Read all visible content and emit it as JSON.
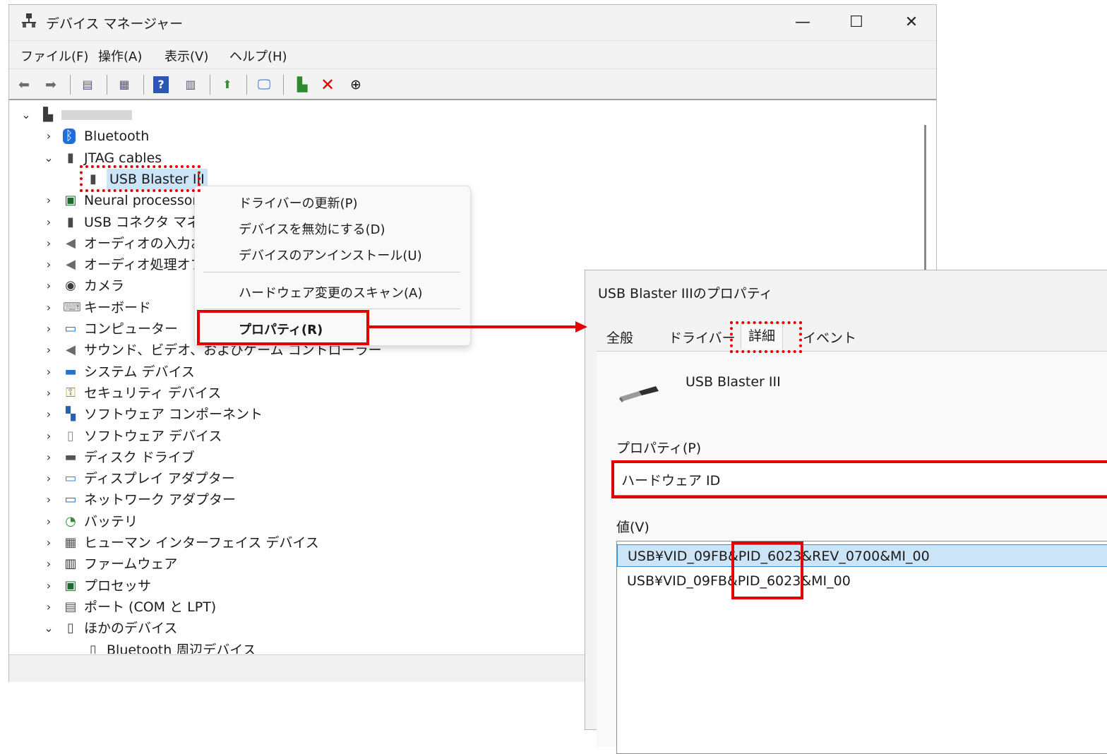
{
  "device_manager": {
    "title": "デバイス マネージャー",
    "menu": [
      "ファイル(F)",
      "操作(A)",
      "表示(V)",
      "ヘルプ(H)"
    ],
    "tree": [
      {
        "label": "",
        "chev": "⌄",
        "level": 0,
        "icon": "computer-icon"
      },
      {
        "label": "Bluetooth",
        "chev": "›",
        "level": 1,
        "icon": "bluetooth-icon"
      },
      {
        "label": "JTAG cables",
        "chev": "⌄",
        "level": 1,
        "icon": "plug-icon"
      },
      {
        "label": "USB Blaster III",
        "chev": "",
        "level": 2,
        "icon": "plug-icon",
        "selected": true
      },
      {
        "label": "Neural processor",
        "chev": "›",
        "level": 1,
        "icon": "chip-icon"
      },
      {
        "label": "USB コネクタ マネー",
        "chev": "›",
        "level": 1,
        "icon": "plug-icon"
      },
      {
        "label": "オーディオの入力お",
        "chev": "›",
        "level": 1,
        "icon": "speaker-icon"
      },
      {
        "label": "オーディオ処理オブジ",
        "chev": "›",
        "level": 1,
        "icon": "speaker-icon"
      },
      {
        "label": "カメラ",
        "chev": "›",
        "level": 1,
        "icon": "camera-icon"
      },
      {
        "label": "キーボード",
        "chev": "›",
        "level": 1,
        "icon": "keyboard-icon"
      },
      {
        "label": "コンピューター",
        "chev": "›",
        "level": 1,
        "icon": "monitor-icon"
      },
      {
        "label": "サウンド、ビデオ、およびゲーム コントローラー",
        "chev": "›",
        "level": 1,
        "icon": "speaker-icon"
      },
      {
        "label": "システム デバイス",
        "chev": "›",
        "level": 1,
        "icon": "folder-icon"
      },
      {
        "label": "セキュリティ デバイス",
        "chev": "›",
        "level": 1,
        "icon": "key-icon"
      },
      {
        "label": "ソフトウェア コンポーネント",
        "chev": "›",
        "level": 1,
        "icon": "component-icon"
      },
      {
        "label": "ソフトウェア デバイス",
        "chev": "›",
        "level": 1,
        "icon": "device-icon"
      },
      {
        "label": "ディスク ドライブ",
        "chev": "›",
        "level": 1,
        "icon": "disk-icon"
      },
      {
        "label": "ディスプレイ アダプター",
        "chev": "›",
        "level": 1,
        "icon": "display-icon"
      },
      {
        "label": "ネットワーク アダプター",
        "chev": "›",
        "level": 1,
        "icon": "network-icon"
      },
      {
        "label": "バッテリ",
        "chev": "›",
        "level": 1,
        "icon": "battery-icon"
      },
      {
        "label": "ヒューマン インターフェイス デバイス",
        "chev": "›",
        "level": 1,
        "icon": "hid-icon"
      },
      {
        "label": "ファームウェア",
        "chev": "›",
        "level": 1,
        "icon": "firmware-icon"
      },
      {
        "label": "プロセッサ",
        "chev": "›",
        "level": 1,
        "icon": "chip-icon"
      },
      {
        "label": "ポート (COM と LPT)",
        "chev": "›",
        "level": 1,
        "icon": "port-icon"
      },
      {
        "label": "ほかのデバイス",
        "chev": "⌄",
        "level": 1,
        "icon": "unknown-device-icon"
      },
      {
        "label": "Bluetooth 周辺デバイス",
        "chev": "",
        "level": 2,
        "icon": "unknown-device-icon"
      }
    ]
  },
  "context_menu": {
    "items": [
      "ドライバーの更新(P)",
      "デバイスを無効にする(D)",
      "デバイスのアンインストール(U)",
      "ハードウェア変更のスキャン(A)",
      "プロパティ(R)"
    ]
  },
  "properties_dialog": {
    "title": "USB Blaster IIIのプロパティ",
    "tabs": [
      "全般",
      "ドライバー",
      "詳細",
      "イベント"
    ],
    "device_name": "USB Blaster III",
    "property_label": "プロパティ(P)",
    "property_value": "ハードウェア ID",
    "value_label": "値(V)",
    "values": [
      "USB¥VID_09FB&PID_6023&REV_0700&MI_00",
      "USB¥VID_09FB&PID_6023&MI_00"
    ]
  },
  "colors": {
    "annotation": "#e30000",
    "selection": "#cce4f7",
    "selection_border": "#3a8fd9"
  }
}
